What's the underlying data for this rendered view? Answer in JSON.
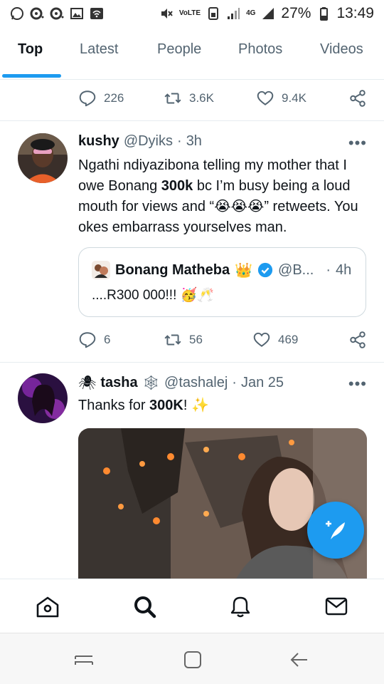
{
  "status_bar": {
    "battery": "27%",
    "time": "13:49",
    "network": "4G",
    "volte": "VoLTE"
  },
  "tabs": [
    {
      "label": "Top",
      "active": true
    },
    {
      "label": "Latest"
    },
    {
      "label": "People"
    },
    {
      "label": "Photos"
    },
    {
      "label": "Videos"
    }
  ],
  "prev_tweet_actions": {
    "replies": "226",
    "retweets": "3.6K",
    "likes": "9.4K"
  },
  "tweet1": {
    "name": "kushy",
    "handle": "@Dyiks",
    "time": "3h",
    "text_part1": "Ngathi ndiyazibona telling my mother that I owe Bonang ",
    "text_bold": "300k",
    "text_part2": " bc I’m busy being a loud mouth for views and “",
    "emoji": "😭😭😭",
    "text_part3": "” retweets. You okes embarrass yourselves man.",
    "quote": {
      "name": "Bonang Matheba",
      "name_emoji": "👑",
      "handle": "@B...",
      "time": "4h",
      "text": "....R300 000!!!",
      "text_emoji": "🥳🥂"
    },
    "replies": "6",
    "retweets": "56",
    "likes": "469"
  },
  "tweet2": {
    "name_prefix_emoji": "🕷",
    "name": "tasha",
    "name_suffix_emoji": "🕸",
    "handle": "@tashalej",
    "time": "Jan 25",
    "text_part1": "Thanks for ",
    "text_bold": "300K",
    "text_part2": "! ",
    "emoji": "✨"
  },
  "more_label": "•••",
  "separator": "·",
  "colors": {
    "accent": "#1d9bf0",
    "muted": "#536471",
    "verified": "#1d9bf0"
  },
  "icons": {
    "bottom_nav": [
      "home-icon",
      "search-icon",
      "notifications-icon",
      "messages-icon"
    ],
    "system_nav": [
      "recent-apps-icon",
      "home-system-icon",
      "back-icon"
    ]
  }
}
